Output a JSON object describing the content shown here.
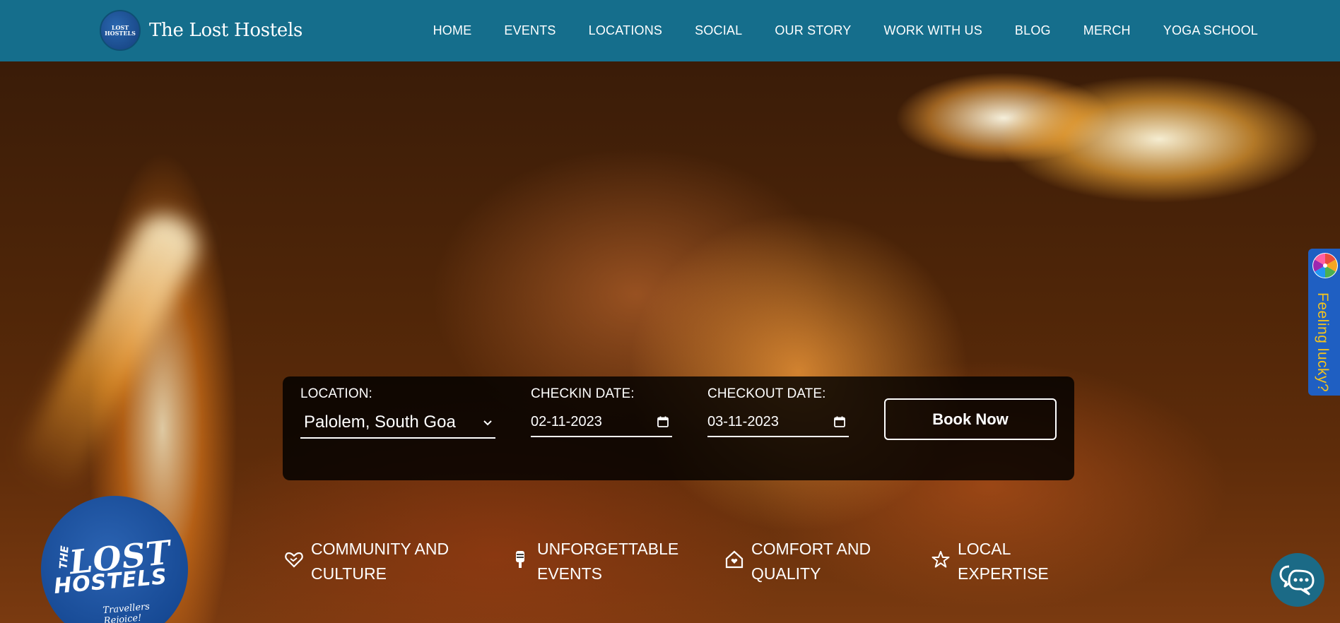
{
  "header": {
    "brand_name": "The Lost Hostels",
    "logo_text": "LOST HOSTELS",
    "nav": [
      {
        "label": "HOME"
      },
      {
        "label": "EVENTS"
      },
      {
        "label": "LOCATIONS"
      },
      {
        "label": "SOCIAL"
      },
      {
        "label": "OUR STORY"
      },
      {
        "label": "WORK WITH US"
      },
      {
        "label": "BLOG"
      },
      {
        "label": "MERCH"
      },
      {
        "label": "YOGA SCHOOL"
      }
    ]
  },
  "booking": {
    "location_label": "LOCATION:",
    "location_value": "Palolem, South Goa",
    "checkin_label": "CHECKIN DATE:",
    "checkin_value": "02-11-2023",
    "checkout_label": "CHECKOUT DATE:",
    "checkout_value": "03-11-2023",
    "book_label": "Book Now"
  },
  "features": [
    {
      "icon": "heart-handshake-icon",
      "text": "COMMUNITY AND\nCULTURE"
    },
    {
      "icon": "microphone-icon",
      "text": "UNFORGETTABLE\nEVENTS"
    },
    {
      "icon": "house-icon",
      "text": "COMFORT AND\nQUALITY"
    },
    {
      "icon": "star-icon",
      "text": "LOCAL\nEXPERTISE"
    }
  ],
  "big_logo": {
    "the": "THE",
    "lost": "LOST",
    "hostels": "HOSTELS",
    "tagline": "Travellers Rejoice!"
  },
  "lucky": {
    "label": "Feeling lucky?"
  },
  "colors": {
    "header_bg": "#156e8c",
    "lucky_bg": "#1f5fc2",
    "lucky_text": "#f2c21f",
    "chat_bg": "#1b6a86"
  }
}
